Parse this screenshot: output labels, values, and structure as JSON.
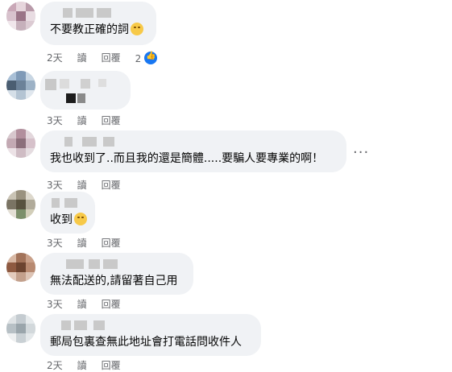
{
  "comments": [
    {
      "text": "不要教正確的詞",
      "time": "2天",
      "read": "讀",
      "reply": "回覆",
      "reactions": "2"
    },
    {
      "text": "",
      "time": "3天",
      "read": "讀",
      "reply": "回覆"
    },
    {
      "text": "我也收到了..而且我的還是簡體.....要騙人要專業的啊！",
      "time": "3天",
      "read": "讀",
      "reply": "回覆"
    },
    {
      "text": "收到",
      "time": "3天",
      "read": "讀",
      "reply": "回覆"
    },
    {
      "text": "無法配送的,請留著自己用",
      "time": "3天",
      "read": "讀",
      "reply": "回覆"
    },
    {
      "text": "郵局包裏查無此地址會打電話問收件人",
      "time": "2天",
      "read": "讀",
      "reply": "回覆"
    }
  ],
  "more_label": "...",
  "icons": {
    "like": "like-icon",
    "emoji": "emoji-icon",
    "more": "more-options-icon"
  },
  "colors": {
    "bubble": "#f0f2f5",
    "meta_text": "#65676b",
    "like_blue": "#1877f2"
  }
}
